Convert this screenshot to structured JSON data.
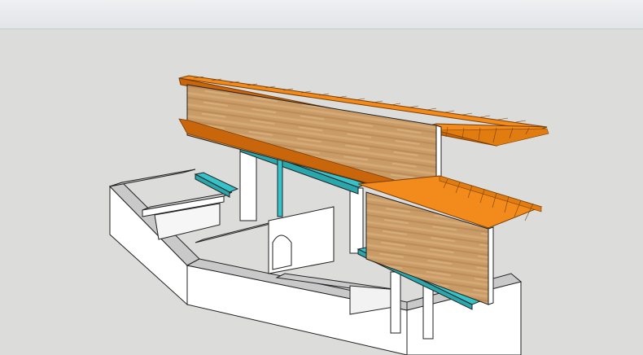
{
  "window": {
    "title": ""
  },
  "viewport": {
    "background": "#dcdcda",
    "model": "3d-house-model-with-wood-beam-canopy"
  },
  "colors": {
    "wall_face": "#ffffff",
    "wall_top": "#c9c9c9",
    "wood": "#c99b66",
    "wood_dark": "#a97a47",
    "joist": "#f28b1c",
    "joist_dark": "#c9650a",
    "steel": "#35c2c9",
    "edge": "#222222"
  }
}
